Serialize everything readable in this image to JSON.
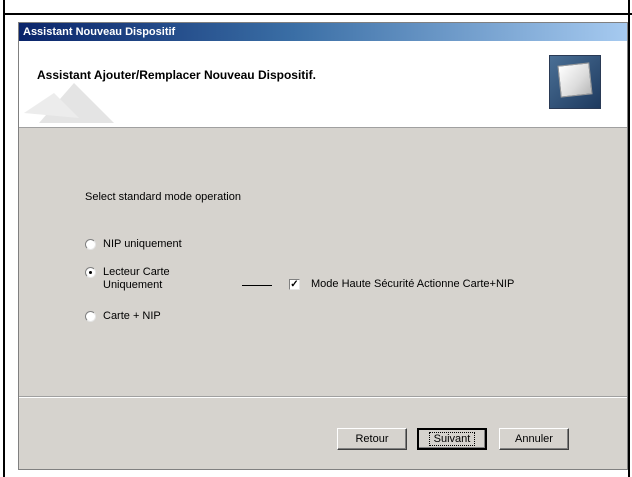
{
  "window": {
    "title": "Assistant Nouveau Dispositif"
  },
  "header": {
    "title": "Assistant Ajouter/Remplacer Nouveau Dispositif."
  },
  "prompt": "Select standard mode operation",
  "options": [
    {
      "label": "NIP uniquement",
      "selected": false
    },
    {
      "label": "Lecteur Carte Uniquement",
      "selected": true
    },
    {
      "label": "Carte + NIP",
      "selected": false
    }
  ],
  "high_security": {
    "label": "Mode Haute Sécurité Actionne Carte+NIP",
    "checked": true
  },
  "buttons": {
    "back": "Retour",
    "next": "Suivant",
    "cancel": "Annuler"
  }
}
